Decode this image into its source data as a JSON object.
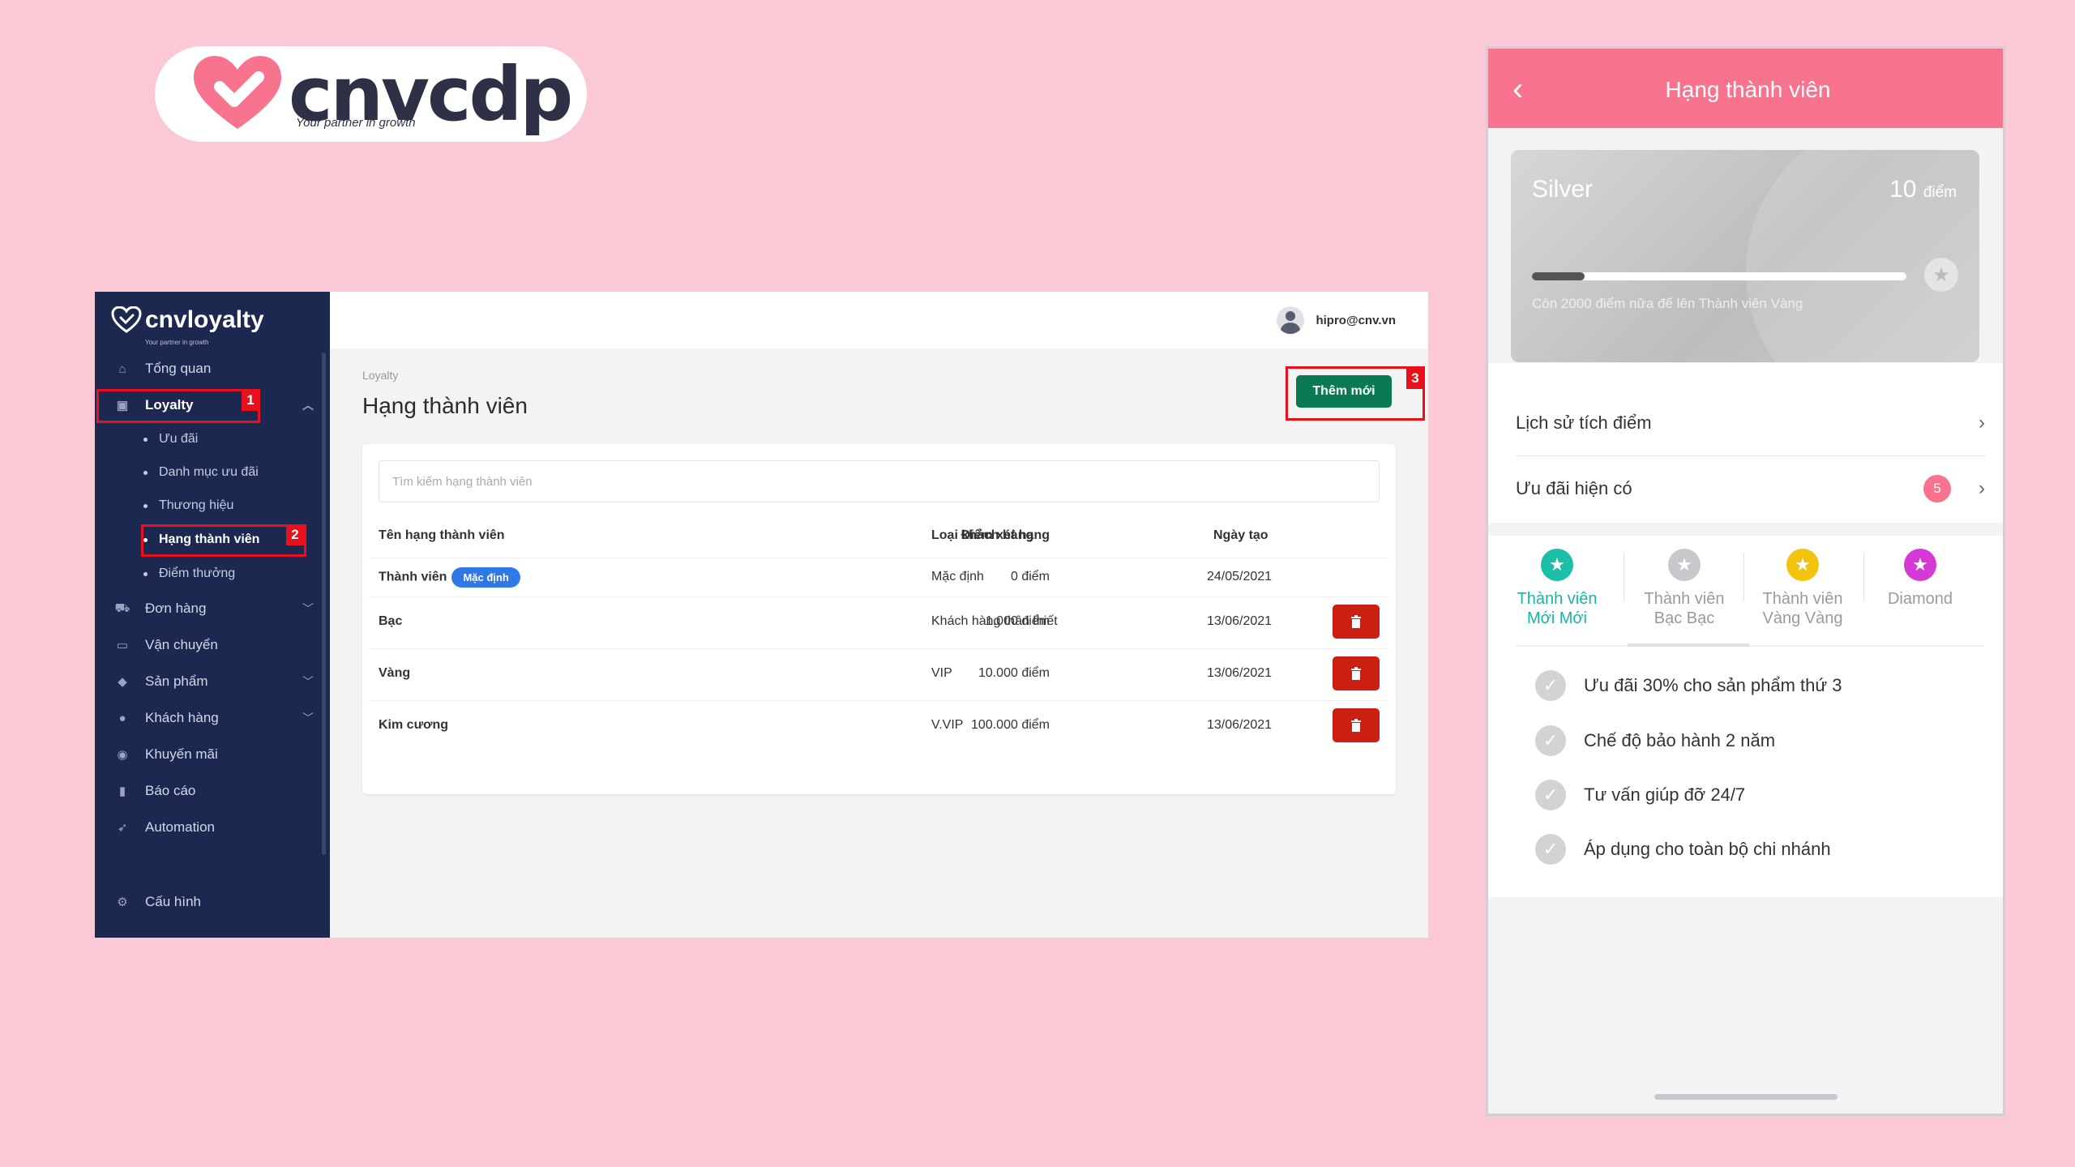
{
  "brand": {
    "name": "cnvcdp",
    "tagline": "Your partner in growth",
    "color": "#f8738e"
  },
  "admin": {
    "logo": {
      "name": "cnvloyalty",
      "tagline": "Your partner in growth"
    },
    "nav": {
      "overview": "Tổng quan",
      "loyalty": "Loyalty",
      "sub": {
        "offers": "Ưu đãi",
        "offer_categories": "Danh mục ưu đãi",
        "brands": "Thương hiệu",
        "member_tiers": "Hạng thành viên",
        "reward_points": "Điểm thưởng"
      },
      "orders": "Đơn hàng",
      "shipping": "Vận chuyển",
      "products": "Sản phẩm",
      "customers": "Khách hàng",
      "promotions": "Khuyến mãi",
      "reports": "Báo cáo",
      "automation": "Automation",
      "settings": "Cấu hình"
    },
    "markers": {
      "one": "1",
      "two": "2",
      "three": "3"
    },
    "user": "hipro@cnv.vn",
    "breadcrumb": "Loyalty",
    "page_title": "Hạng thành viên",
    "add_button": "Thêm mới",
    "search_placeholder": "Tìm kiếm hạng thành viên",
    "table": {
      "headers": {
        "name": "Tên hạng thành viên",
        "points": "Điểm xét hạng",
        "type": "Loại khách hàng",
        "date": "Ngày tạo"
      },
      "default_tag": "Mặc định",
      "rows": [
        {
          "name": "Thành viên",
          "points": "0 điểm",
          "type": "Mặc định",
          "date": "24/05/2021"
        },
        {
          "name": "Bạc",
          "points": "1.000 điểm",
          "type": "Khách hàng thân thiết",
          "date": "13/06/2021"
        },
        {
          "name": "Vàng",
          "points": "10.000 điểm",
          "type": "VIP",
          "date": "13/06/2021"
        },
        {
          "name": "Kim cương",
          "points": "100.000 điểm",
          "type": "V.VIP",
          "date": "13/06/2021"
        }
      ]
    }
  },
  "phone": {
    "title": "Hạng thành viên",
    "card": {
      "tier": "Silver",
      "points_value": "10",
      "points_unit": "điểm",
      "progress_fraction": 0.14,
      "note": "Còn 2000 điểm nữa để lên Thành viên Vàng"
    },
    "history": "Lịch sử tích điểm",
    "offers": "Ưu đãi hiện có",
    "offers_count": "5",
    "tabs": [
      {
        "line1": "Thành viên",
        "line2": "Mới Mới",
        "color": "#1dbfa9"
      },
      {
        "line1": "Thành viên",
        "line2": "Bạc Bạc",
        "color": "#c8c8cc"
      },
      {
        "line1": "Thành viên",
        "line2": "Vàng Vàng",
        "color": "#f2c40f"
      },
      {
        "line1": "Diamond",
        "line2": "",
        "color": "#d63ad6"
      }
    ],
    "benefits": [
      "Ưu đãi 30% cho sản phẩm thứ 3",
      "Chế độ bảo hành 2 năm",
      "Tư vấn giúp đỡ 24/7",
      "Áp dụng cho toàn bộ chi nhánh"
    ]
  }
}
